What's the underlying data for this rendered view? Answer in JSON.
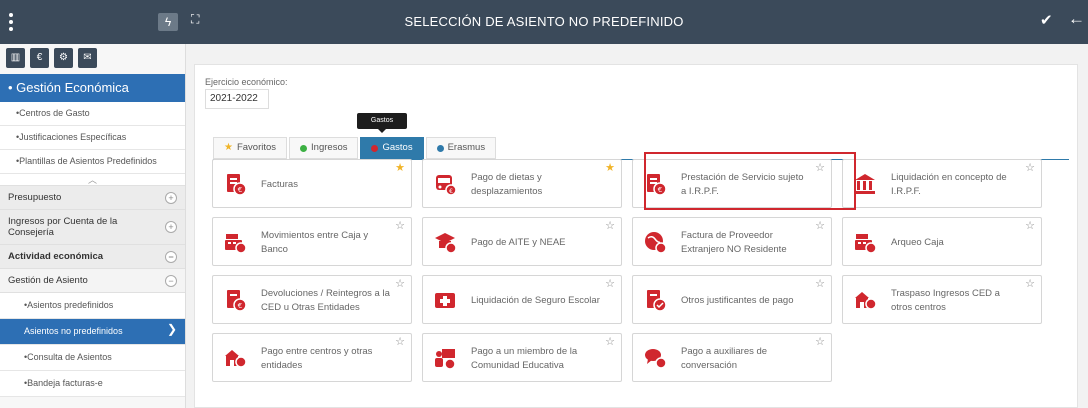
{
  "header": {
    "title": "SELECCIÓN DE ASIENTO NO PREDEFINIDO"
  },
  "sidebar": {
    "section_title": "• Gestión Económica",
    "sub_items": [
      "•Centros de Gasto",
      "•Justificaciones Específicas",
      "•Plantillas de Asientos Predefinidos"
    ],
    "sections": [
      {
        "label": "Presupuesto",
        "toggle": "+"
      },
      {
        "label": "Ingresos por Cuenta de la Consejería",
        "toggle": "+"
      },
      {
        "label": "Actividad económica",
        "toggle": "−"
      },
      {
        "label": "Gestión de Asiento",
        "toggle": "−"
      }
    ],
    "leaves": [
      {
        "label": "•Asientos predefinidos"
      },
      {
        "label": "Asientos no predefinidos"
      },
      {
        "label": "•Consulta de Asientos"
      },
      {
        "label": "•Bandeja facturas-e"
      }
    ]
  },
  "form": {
    "ejercicio_label": "Ejercicio económico:",
    "ejercicio_value": "2021-2022"
  },
  "tooltip": "Gastos",
  "tabs": [
    {
      "label": "Favoritos",
      "dot_color": "#f0b429"
    },
    {
      "label": "Ingresos",
      "dot_color": "#3cb043"
    },
    {
      "label": "Gastos",
      "dot_color": "#d0272e"
    },
    {
      "label": "Erasmus",
      "dot_color": "#2f7aaa"
    }
  ],
  "cards": [
    {
      "label": "Facturas",
      "icon": "invoice-icon",
      "favorite": true
    },
    {
      "label": "Pago de dietas y desplazamientos",
      "icon": "bus-icon",
      "favorite": true
    },
    {
      "label": "Prestación de Servicio sujeto a I.R.P.F.",
      "icon": "document-icon",
      "favorite": false
    },
    {
      "label": "Liquidación en concepto de I.R.P.F.",
      "icon": "bank-icon",
      "favorite": false
    },
    {
      "label": "Movimientos entre Caja y Banco",
      "icon": "cash-register-icon",
      "favorite": false
    },
    {
      "label": "Pago de AITE y NEAE",
      "icon": "graduation-icon",
      "favorite": false
    },
    {
      "label": "Factura de Proveedor Extranjero NO Residente",
      "icon": "globe-icon",
      "favorite": false
    },
    {
      "label": "Arqueo Caja",
      "icon": "cash-register-icon",
      "favorite": false
    },
    {
      "label": "Devoluciones / Reintegros a la CED u Otras Entidades",
      "icon": "refund-icon",
      "favorite": false
    },
    {
      "label": "Liquidación de Seguro Escolar",
      "icon": "medical-kit-icon",
      "favorite": false
    },
    {
      "label": "Otros justificantes de pago",
      "icon": "receipt-check-icon",
      "favorite": false
    },
    {
      "label": "Traspaso Ingresos CED a otros centros",
      "icon": "school-transfer-icon",
      "favorite": false
    },
    {
      "label": "Pago entre centros y otras entidades",
      "icon": "school-transfer-icon",
      "favorite": false
    },
    {
      "label": "Pago a un miembro de la Comunidad Educativa",
      "icon": "person-teacher-icon",
      "favorite": false
    },
    {
      "label": "Pago a auxiliares de conversación",
      "icon": "chat-person-icon",
      "favorite": false
    }
  ],
  "colors": {
    "header_bg": "#3b4a5a",
    "accent_blue": "#2d6fb4",
    "tab_active": "#2f7aaa",
    "icon_red": "#d0272e",
    "star_yellow": "#f0b429",
    "highlight_red": "#d0272e"
  }
}
